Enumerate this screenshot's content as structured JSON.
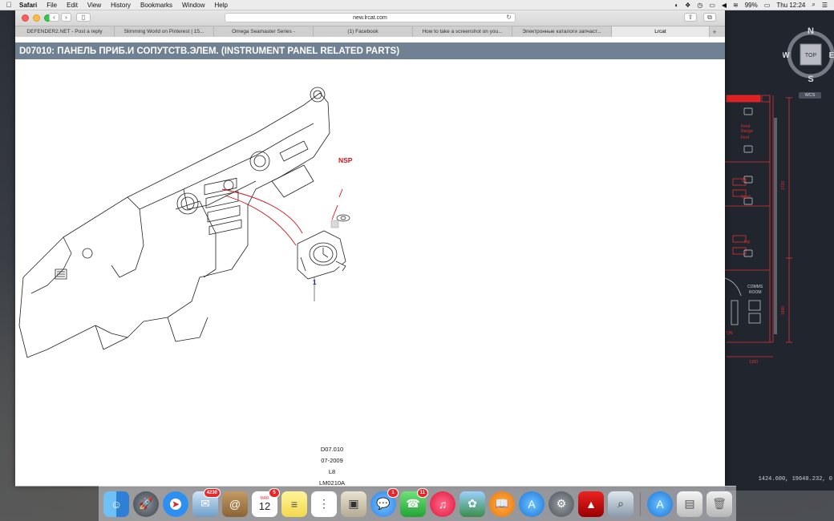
{
  "menubar": {
    "app": "Safari",
    "items": [
      "File",
      "Edit",
      "View",
      "History",
      "Bookmarks",
      "Window",
      "Help"
    ],
    "battery": "99%",
    "clock": "Thu 12:24"
  },
  "browser": {
    "url": "new.lrcat.com",
    "tabs": [
      {
        "label": "DEFENDER2.NET - Post a reply"
      },
      {
        "label": "Slimming World on Pinterest | 15..."
      },
      {
        "label": "Omega Seamaster Series -"
      },
      {
        "label": "(1) Facebook"
      },
      {
        "label": "How to take a screenshot on you..."
      },
      {
        "label": "Электронные каталоги запчаст..."
      },
      {
        "label": "Lrcat"
      }
    ],
    "active_tab": 6
  },
  "page": {
    "title": "D07010: ПАНЕЛЬ ПРИБ.И СОПУТСТВ.ЭЛЕМ. (INSTRUMENT PANEL RELATED PARTS)",
    "callout_nsp": "NSP",
    "callout_part": "1",
    "meta": [
      "D07.010",
      "07-2009",
      "L8",
      "LM0210A"
    ]
  },
  "cad": {
    "compass": {
      "n": "N",
      "s": "S",
      "w": "W",
      "e": "E",
      "top": "TOP"
    },
    "wcs": "WCS",
    "labels": [
      "COMMS",
      "ROOM",
      "1800",
      "1720",
      "1300",
      "Feed",
      "Range",
      "TV",
      "Scarf",
      "Ing",
      "Feet",
      "1ELL",
      "1AT",
      "ON"
    ],
    "coords": "1424.600, 19640.232, 0"
  },
  "dock": {
    "badges": {
      "mail": "4230",
      "calendar": "5",
      "messages": "1",
      "facetime": "11"
    },
    "calendar_month": "MAR",
    "calendar_day": "12"
  }
}
